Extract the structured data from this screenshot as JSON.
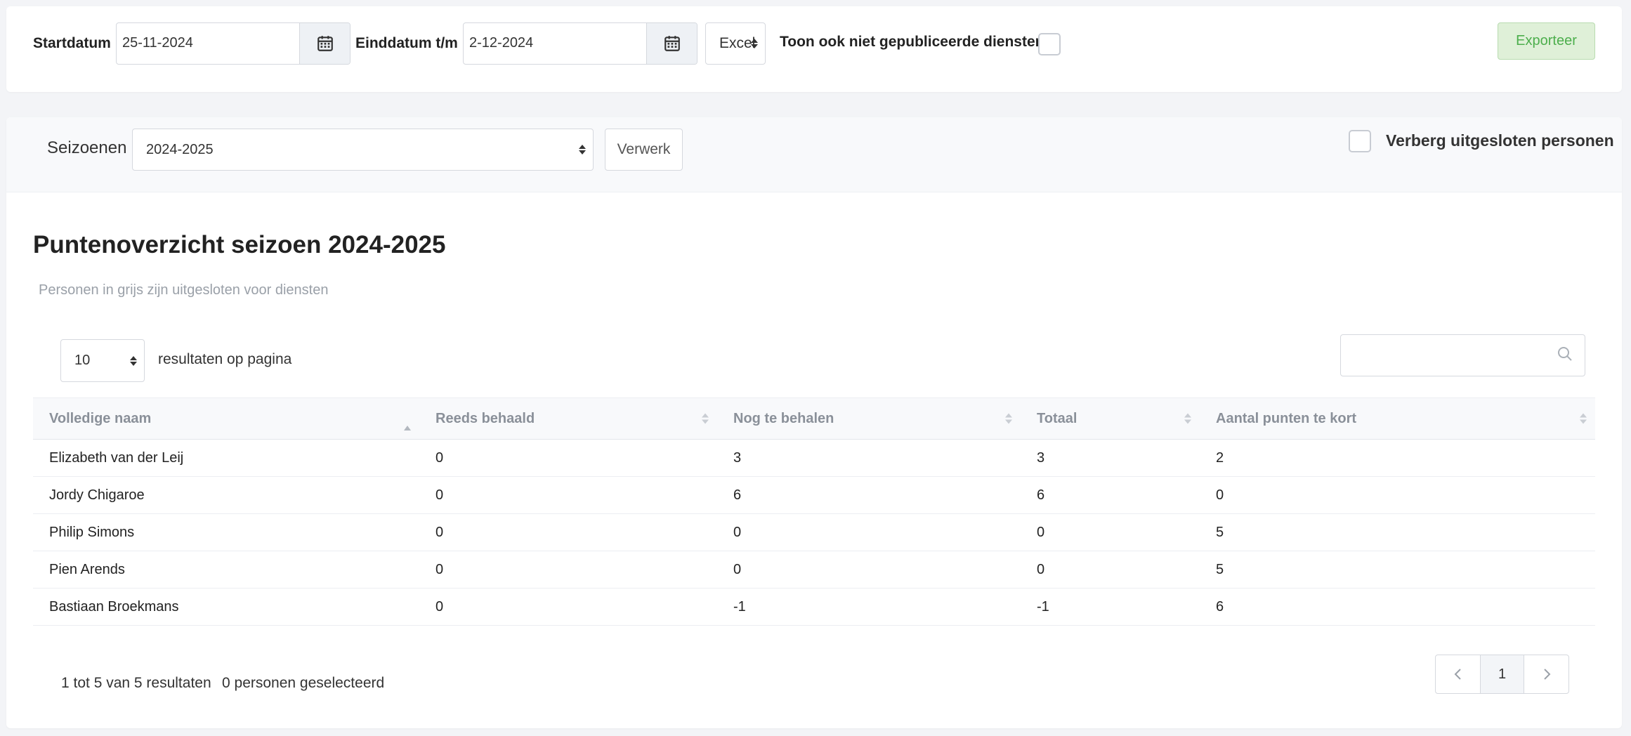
{
  "export_bar": {
    "start_label": "Startdatum",
    "start_value": "25-11-2024",
    "end_label": "Einddatum t/m",
    "end_value": "2-12-2024",
    "format_value": "Excel",
    "unpublished_label": "Toon ook niet gepubliceerde diensten",
    "export_button": "Exporteer"
  },
  "filters": {
    "season_label": "Seizoenen",
    "season_value": "2024-2025",
    "process_button": "Verwerk",
    "hide_excluded_label": "Verberg uitgesloten personen"
  },
  "overview": {
    "title": "Puntenoverzicht seizoen 2024-2025",
    "subtitle": "Personen in grijs zijn uitgesloten voor diensten",
    "page_size": "10",
    "page_size_label": "resultaten op pagina",
    "search_placeholder": ""
  },
  "table": {
    "columns": [
      "Volledige naam",
      "Reeds behaald",
      "Nog te behalen",
      "Totaal",
      "Aantal punten te kort"
    ],
    "rows": [
      [
        "Elizabeth van der Leij",
        "0",
        "3",
        "3",
        "2"
      ],
      [
        "Jordy Chigaroe",
        "0",
        "6",
        "6",
        "0"
      ],
      [
        "Philip Simons",
        "0",
        "0",
        "0",
        "5"
      ],
      [
        "Pien Arends",
        "0",
        "0",
        "0",
        "5"
      ],
      [
        "Bastiaan Broekmans",
        "0",
        "-1",
        "-1",
        "6"
      ]
    ]
  },
  "footer": {
    "results_info": "1 tot 5 van 5 resultaten",
    "selected_info": "0 personen geselecteerd",
    "current_page": "1"
  },
  "colors": {
    "export_button_bg": "#dff0d8",
    "export_button_text": "#4cae4c"
  }
}
